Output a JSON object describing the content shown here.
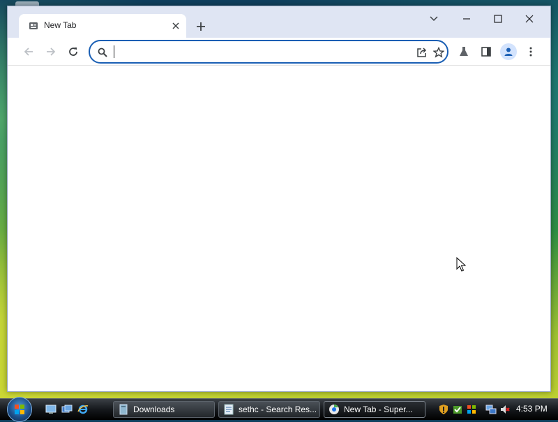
{
  "browser": {
    "tab": {
      "title": "New Tab"
    },
    "omnibox": {
      "value": "",
      "placeholder": ""
    }
  },
  "taskbar": {
    "buttons": [
      {
        "label": "Downloads"
      },
      {
        "label": "sethc - Search Res..."
      },
      {
        "label": "New Tab - Super..."
      }
    ],
    "clock": "4:53 PM"
  },
  "colors": {
    "accent": "#1a5fb4",
    "tabstrip": "#dfe5f3",
    "avatar_bg": "#d3e3fd"
  }
}
